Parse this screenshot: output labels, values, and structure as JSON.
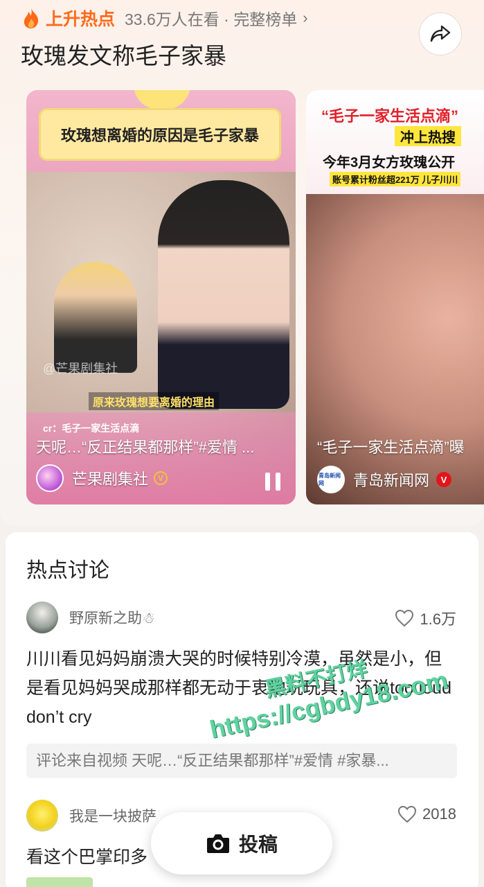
{
  "header": {
    "hot_label": "上升热点",
    "meta": "33.6万人在看 · 完整榜单",
    "chevron": "›",
    "title": "玫瑰发文称毛子家暴",
    "share_icon": "share-arrow-icon"
  },
  "videos": [
    {
      "banner_caption": "玫瑰想离婚的原因是毛子家暴",
      "subtitle": "原来玫瑰想要离婚的理由",
      "watermark": "@芒果剧集社",
      "overlay_small": "cr：毛子一家生活点滴",
      "description": "天呢…“反正结果都那样”#爱情 ...",
      "author": "芒果剧集社",
      "badge": "V",
      "playing": true
    },
    {
      "banner_line1": "“毛子一家生活点滴”",
      "banner_line2": "冲上热搜",
      "banner_line3": "今年3月女方玫瑰公开",
      "banner_line4": "账号累计粉丝超221万 儿子川川",
      "description": "“毛子一家生活点滴”曝",
      "author": "青岛新闻网",
      "avatar_text": "青岛新闻网",
      "badge": "V"
    }
  ],
  "discussion": {
    "title": "热点讨论",
    "comments": [
      {
        "user": "野原新之助☃",
        "likes": "1.6万",
        "text": "川川看见妈妈崩溃大哭的时候特别冷漠，虽然是小，但是看见妈妈哭成那样都无动于衷地玩玩具，还说too loud don’t cry",
        "source": "评论来自视频 天呢…“反正结果都那样”#爱情 #家暴..."
      },
      {
        "user": "我是一块披萨",
        "likes": "2018",
        "text": "看这个巴掌印多"
      }
    ]
  },
  "watermark": {
    "line1": "黑料不打烊",
    "line2": "https://cgbdy18.com"
  },
  "fab": {
    "label": "投稿",
    "icon": "camera-icon"
  },
  "colors": {
    "accent": "#ff6a1a",
    "verified_red": "#e3151b",
    "verified_yellow": "#f3c13a"
  }
}
